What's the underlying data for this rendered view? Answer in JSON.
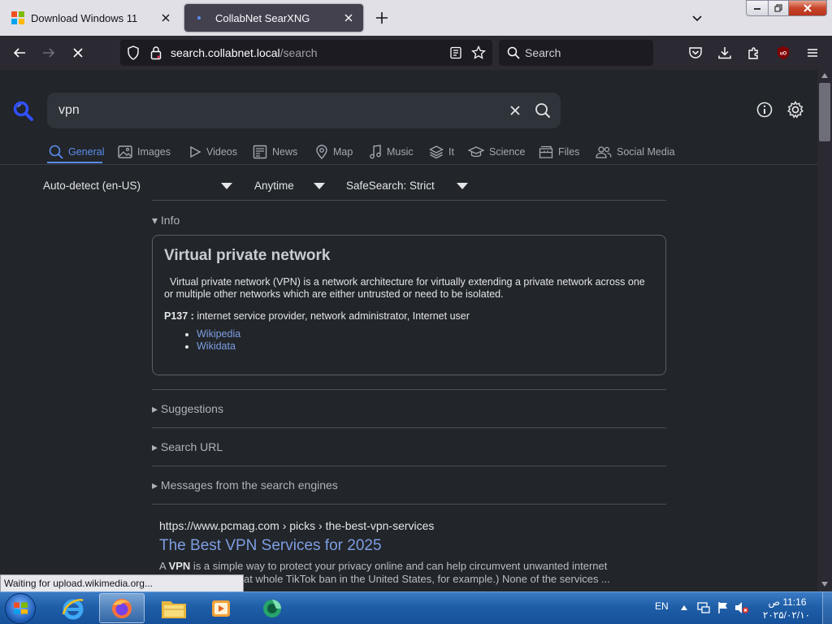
{
  "browser": {
    "tabs": [
      {
        "label": "Download Windows 11"
      },
      {
        "label": "CollabNet SearXNG"
      }
    ],
    "url": {
      "host": "search.collabnet.local",
      "path": "/search"
    },
    "search_placeholder": "Search",
    "status": "Waiting for upload.wikimedia.org..."
  },
  "search": {
    "query": "vpn",
    "categories": [
      "General",
      "Images",
      "Videos",
      "News",
      "Map",
      "Music",
      "It",
      "Science",
      "Files",
      "Social Media"
    ],
    "filters": {
      "language": "Auto-detect (en-US)",
      "time": "Anytime",
      "safesearch": "SafeSearch: Strict"
    }
  },
  "info": {
    "toggle": "▾ Info",
    "title": "Virtual private network",
    "description": "Virtual private network (VPN) is a network architecture for virtually extending a private network across one or multiple other networks which are either untrusted or need to be isolated.",
    "attr_key": "P137 :",
    "attr_value": "internet service provider, network administrator, Internet user",
    "links": [
      "Wikipedia",
      "Wikidata"
    ]
  },
  "sections": [
    "▸ Suggestions",
    "▸ Search URL",
    "▸ Messages from the search engines"
  ],
  "result": {
    "url": "https://www.pcmag.com",
    "breadcrumb": " › picks › the-best-vpn-services",
    "title": "The Best VPN Services for 2025",
    "snippet_a": "A ",
    "snippet_bold": "VPN",
    "snippet_b": " is a simple way to protect your privacy online and can help circumvent unwanted internet",
    "snippet_line2": "at whole TikTok ban in the United States, for example.) None of the services ..."
  },
  "taskbar": {
    "lang": "EN",
    "time": "11:16 ص",
    "date": "۲۰۲۵/۰۲/۱۰"
  },
  "colors": {
    "accent": "#5b8def",
    "link": "#7d9ee4",
    "page_bg": "#222529",
    "search_icon": "#3050ff"
  }
}
